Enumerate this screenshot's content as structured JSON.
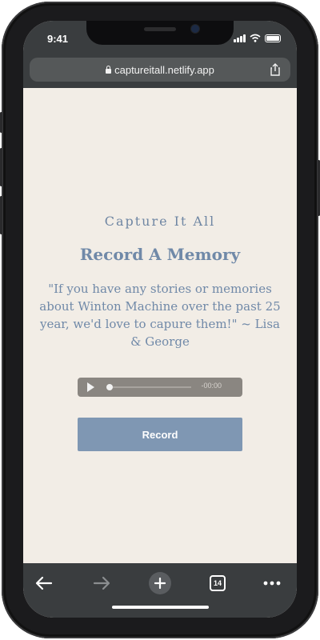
{
  "status": {
    "time": "9:41"
  },
  "browser": {
    "url": "captureitall.netlify.app",
    "tab_count": "14"
  },
  "page": {
    "eyebrow": "Capture It All",
    "title": "Record A Memory",
    "quote": "\"If you have any stories or memories about Winton Machine over the past 25 year, we'd love to capure them!\" ~ Lisa & George",
    "audio_time": "-00:00",
    "audio_progress": 0,
    "record_label": "Record"
  },
  "icons": {
    "lock": "lock-icon",
    "share": "share-icon",
    "back": "back-arrow-icon",
    "forward": "forward-arrow-icon",
    "new_tab": "plus-icon",
    "tabs": "tabs-icon",
    "more": "more-dots-icon",
    "play": "play-icon"
  },
  "colors": {
    "page_background": "#f2ede6",
    "accent_text": "#7089a8",
    "record_button": "#7f97b3",
    "audio_player": "#8a8681",
    "browser_chrome": "#3a3d3f"
  }
}
